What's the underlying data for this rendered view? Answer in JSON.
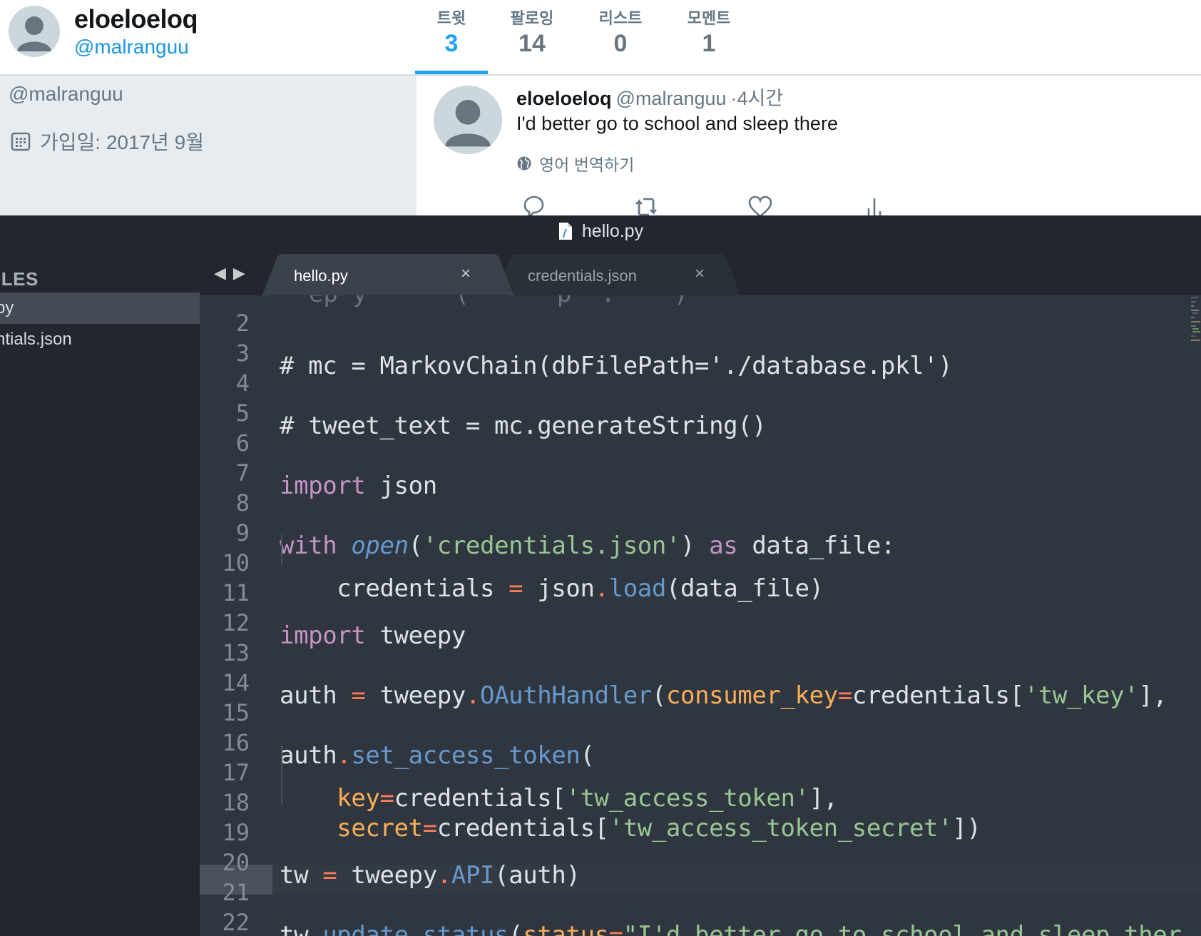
{
  "twitter": {
    "profile": {
      "name": "eloeloeloq",
      "handle": "@malranguu"
    },
    "stats": [
      {
        "label": "트윗",
        "value": "3"
      },
      {
        "label": "팔로잉",
        "value": "14"
      },
      {
        "label": "리스트",
        "value": "0"
      },
      {
        "label": "모멘트",
        "value": "1"
      }
    ],
    "side": {
      "handle": "@malranguu",
      "joined": "가입일: 2017년 9월"
    },
    "tweet": {
      "name": "eloeloeloq",
      "handle": "@malranguu",
      "time": "·4시간",
      "text": "I'd better go to school and sleep there",
      "translate": "영어 번역하기"
    }
  },
  "editor": {
    "window_title": "hello.py",
    "sidebar": {
      "header": "ILES",
      "files": [
        "py",
        "ntials.json"
      ]
    },
    "tabs": [
      {
        "label": "hello.py",
        "close": "×"
      },
      {
        "label": "credentials.json",
        "close": "×"
      }
    ],
    "scrolled_line_peek": "  ep y      (      p  .    )",
    "lines": [
      {
        "n": "2",
        "text": ""
      },
      {
        "n": "3",
        "text": "# mc = MarkovChain(dbFilePath='./database.pkl')"
      },
      {
        "n": "4",
        "text": ""
      },
      {
        "n": "5",
        "text": "# tweet_text = mc.generateString()"
      },
      {
        "n": "6",
        "text": ""
      },
      {
        "n": "7",
        "text": "import json"
      },
      {
        "n": "8",
        "text": ""
      },
      {
        "n": "9",
        "text": "with open('credentials.json') as data_file:"
      },
      {
        "n": "10",
        "text": "    credentials = json.load(data_file)"
      },
      {
        "n": "11",
        "text": ""
      },
      {
        "n": "12",
        "text": "import tweepy"
      },
      {
        "n": "13",
        "text": ""
      },
      {
        "n": "14",
        "text": "auth = tweepy.OAuthHandler(consumer_key=credentials['tw_key'], "
      },
      {
        "n": "15",
        "text": ""
      },
      {
        "n": "16",
        "text": "auth.set_access_token("
      },
      {
        "n": "17",
        "text": "    key=credentials['tw_access_token'],"
      },
      {
        "n": "18",
        "text": "    secret=credentials['tw_access_token_secret'])"
      },
      {
        "n": "19",
        "text": ""
      },
      {
        "n": "20",
        "text": "tw = tweepy.API(auth)"
      },
      {
        "n": "21",
        "text": ""
      },
      {
        "n": "22",
        "text": "tw.update_status(status=\"I'd better go to school and sleep ther"
      }
    ],
    "colors": {
      "background": "#303640",
      "keyword": "#c594c5",
      "string": "#99c794",
      "function": "#6699cc",
      "operator": "#f97b58",
      "parameter": "#f9ae58"
    }
  }
}
